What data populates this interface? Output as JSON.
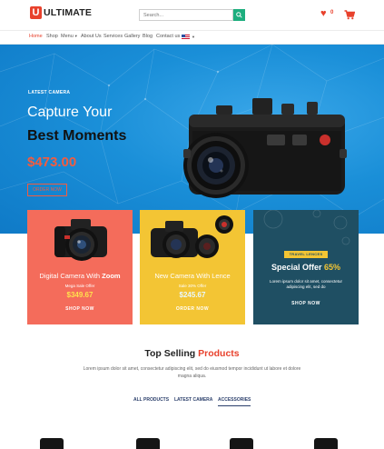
{
  "header": {
    "logo_mark": "U",
    "logo_text": "ULTIMATE",
    "search_placeholder": "Search...",
    "wishlist_count": "0"
  },
  "nav": {
    "items": [
      {
        "label": "Home"
      },
      {
        "label": "Shop"
      },
      {
        "label": "Menu"
      },
      {
        "label": "About Us"
      },
      {
        "label": "Services"
      },
      {
        "label": "Gallery"
      },
      {
        "label": "Blog"
      },
      {
        "label": "Contact us"
      }
    ]
  },
  "hero": {
    "subtitle": "LATEST CAMERA",
    "title_line1": "Capture Your",
    "title_line2": "Best Moments",
    "price": "$473.00",
    "button": "ORDER NOW"
  },
  "cards": [
    {
      "title_plain": "Digital Camera With ",
      "title_bold": "Zoom",
      "small": "Mega Sale Offer",
      "price": "$349.67",
      "cta": "SHOP NOW"
    },
    {
      "title_plain": "New Camera With Lence",
      "small": "Sale 30% Offer",
      "price": "$245.67",
      "cta": "ORDER NOW"
    },
    {
      "badge": "TRAVEL LENCES",
      "title_plain": "Special Offer ",
      "title_accent": "65%",
      "desc": "Lorem ipsum dolor sit amet, consectetur adipiscing elit, sed do",
      "cta": "SHOP NOW"
    }
  ],
  "top_selling": {
    "title_plain": "Top Selling ",
    "title_accent": "Products",
    "desc": "Lorem ipsum dolor sit amet, consectetur adipiscing elit, sed do eiusmod tempor incididunt ut labore et dolore magna aliqua.",
    "tabs": [
      {
        "label": "ALL PRODUCTS"
      },
      {
        "label": "LATEST CAMERA"
      },
      {
        "label": "ACCESSORIES"
      }
    ]
  },
  "colors": {
    "accent": "#e8412c",
    "hero_blue": "#1a8fd8",
    "card_coral": "#f46c5b",
    "card_yellow": "#f3c534",
    "card_teal": "#1f4f63",
    "search_green": "#1dae7e"
  },
  "icons": [
    "search-icon",
    "heart-icon",
    "cart-icon",
    "us-flag-icon",
    "chevron-down-icon"
  ]
}
